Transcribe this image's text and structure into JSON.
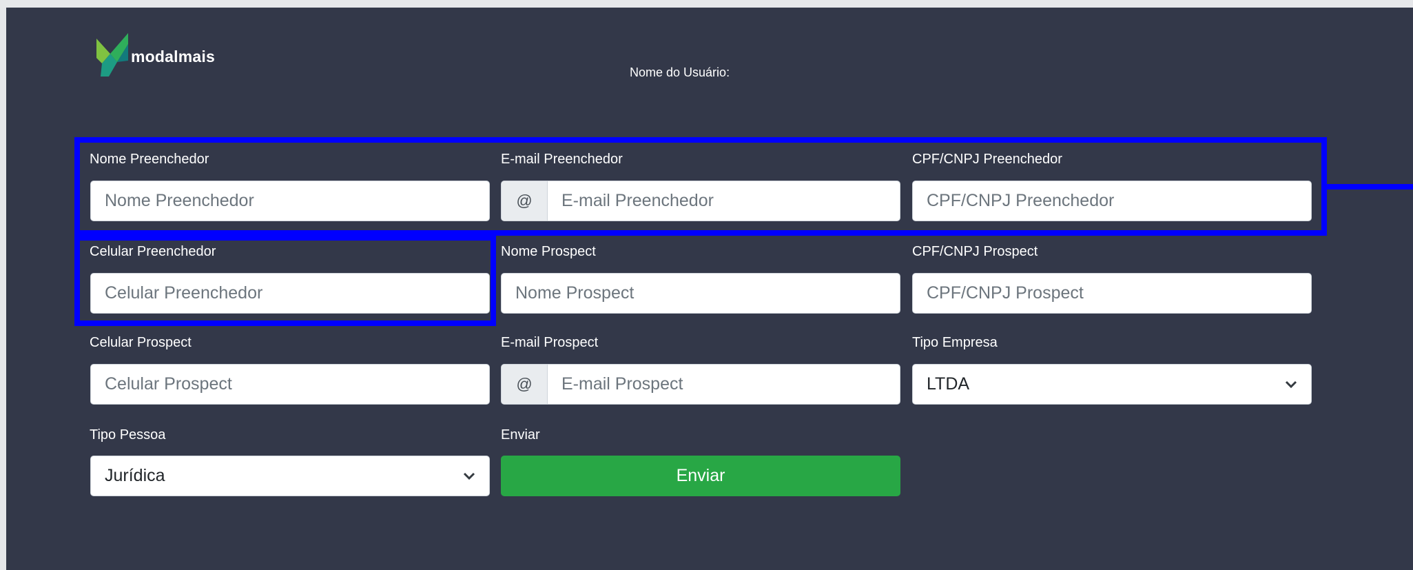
{
  "header": {
    "logo_text": "modalmais",
    "username_label": "Nome do Usuário:"
  },
  "form": {
    "nome_preenchedor": {
      "label": "Nome Preenchedor",
      "placeholder": "Nome Preenchedor"
    },
    "email_preenchedor": {
      "label": "E-mail Preenchedor",
      "addon": "@",
      "placeholder": "E-mail Preenchedor"
    },
    "cpf_preenchedor": {
      "label": "CPF/CNPJ Preenchedor",
      "placeholder": "CPF/CNPJ Preenchedor"
    },
    "celular_preenchedor": {
      "label": "Celular Preenchedor",
      "placeholder": "Celular Preenchedor"
    },
    "nome_prospect": {
      "label": "Nome Prospect",
      "placeholder": "Nome Prospect"
    },
    "cpf_prospect": {
      "label": "CPF/CNPJ Prospect",
      "placeholder": "CPF/CNPJ Prospect"
    },
    "celular_prospect": {
      "label": "Celular Prospect",
      "placeholder": "Celular Prospect"
    },
    "email_prospect": {
      "label": "E-mail Prospect",
      "addon": "@",
      "placeholder": "E-mail Prospect"
    },
    "tipo_empresa": {
      "label": "Tipo Empresa",
      "value": "LTDA"
    },
    "tipo_pessoa": {
      "label": "Tipo Pessoa",
      "value": "Jurídica"
    },
    "enviar": {
      "label": "Enviar",
      "button": "Enviar"
    }
  },
  "colors": {
    "background": "#333849",
    "highlight": "#0000ff",
    "button": "#28a745"
  },
  "icons": [
    "modalmais-logo-icon",
    "chevron-down-icon"
  ]
}
